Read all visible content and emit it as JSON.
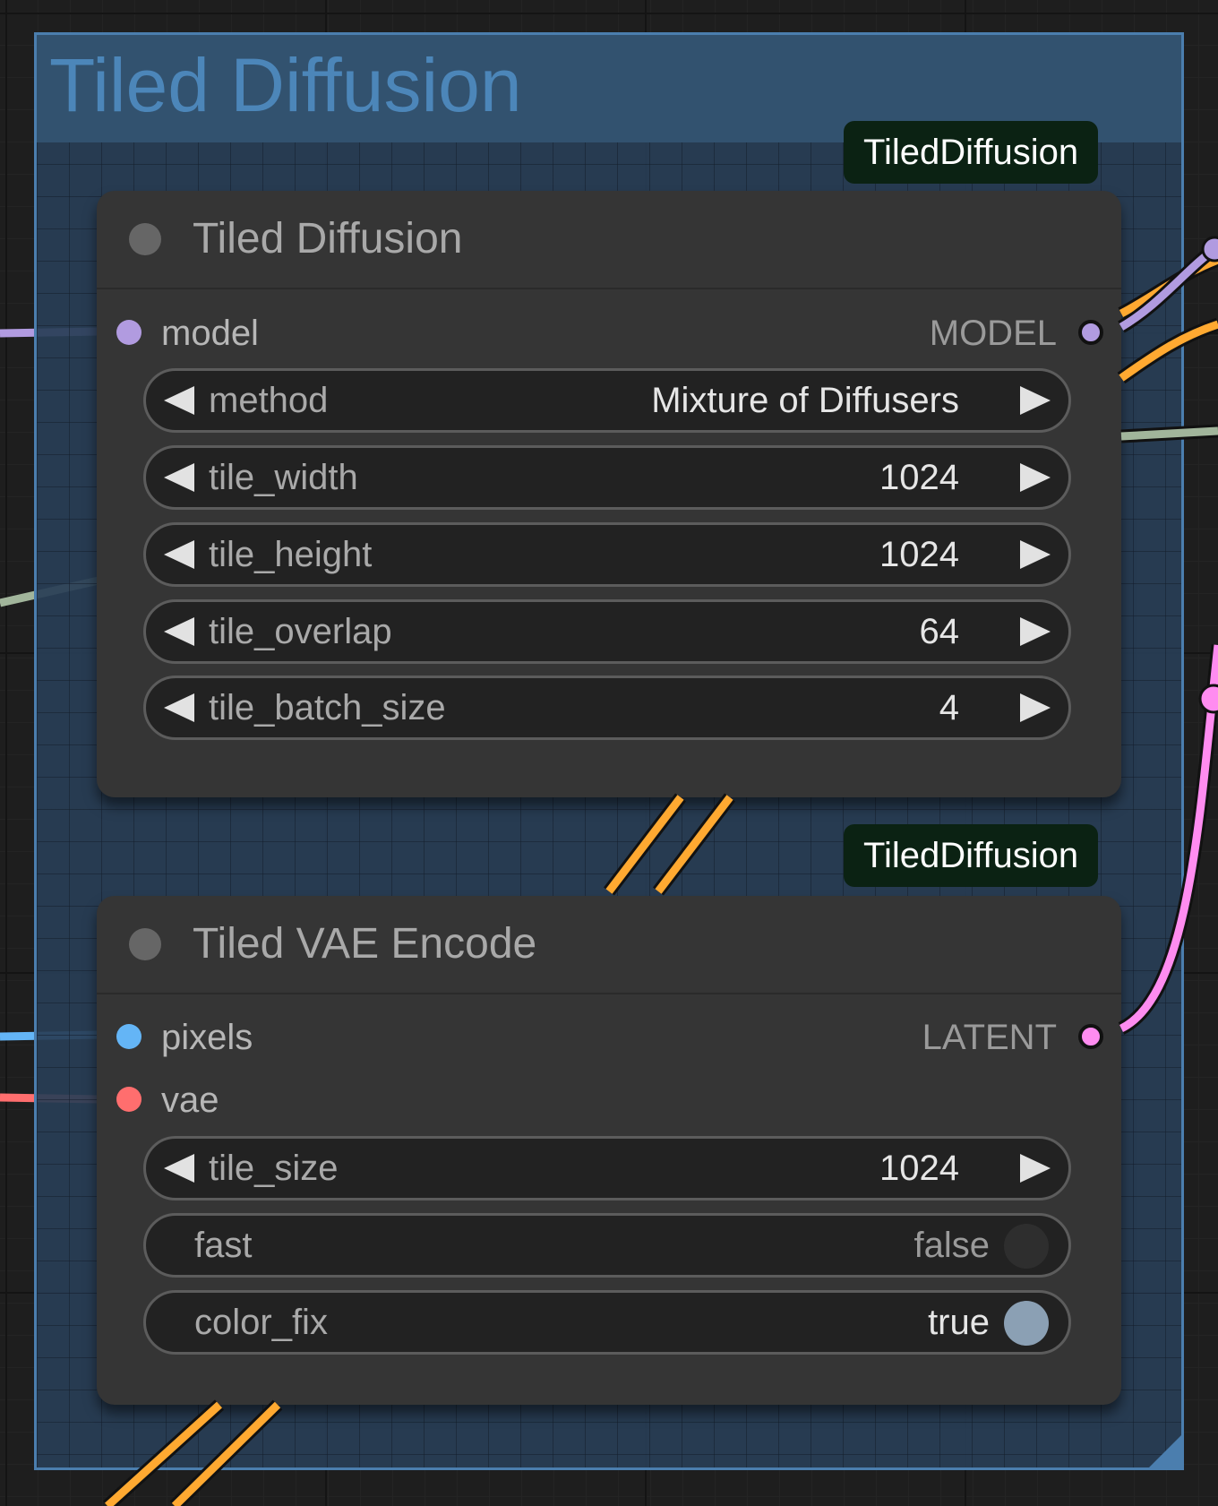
{
  "group": {
    "title": "Tiled Diffusion",
    "color": "#4b7eae"
  },
  "link_colors": {
    "model": "#b19be0",
    "latent": "#ff8cf0",
    "pixels": "#64b5f6",
    "vae": "#ff6e6e",
    "conditioning": "#ffa931",
    "other": "#a1b59b"
  },
  "node_tiled_diffusion": {
    "badge": "TiledDiffusion",
    "title": "Tiled Diffusion",
    "input": {
      "label": "model",
      "color": "#b19be0"
    },
    "output": {
      "label": "MODEL",
      "color": "#b19be0"
    },
    "widgets": [
      {
        "name": "method",
        "value": "Mixture of Diffusers"
      },
      {
        "name": "tile_width",
        "value": "1024"
      },
      {
        "name": "tile_height",
        "value": "1024"
      },
      {
        "name": "tile_overlap",
        "value": "64"
      },
      {
        "name": "tile_batch_size",
        "value": "4"
      }
    ]
  },
  "node_tiled_vae_encode": {
    "badge": "TiledDiffusion",
    "title": "Tiled VAE Encode",
    "inputs": [
      {
        "label": "pixels",
        "color": "#64b5f6"
      },
      {
        "label": "vae",
        "color": "#ff6e6e"
      }
    ],
    "output": {
      "label": "LATENT",
      "color": "#ff8cf0"
    },
    "widgets": [
      {
        "name": "tile_size",
        "value": "1024"
      }
    ],
    "toggles": [
      {
        "name": "fast",
        "value": "false",
        "on": false
      },
      {
        "name": "color_fix",
        "value": "true",
        "on": true
      }
    ]
  }
}
